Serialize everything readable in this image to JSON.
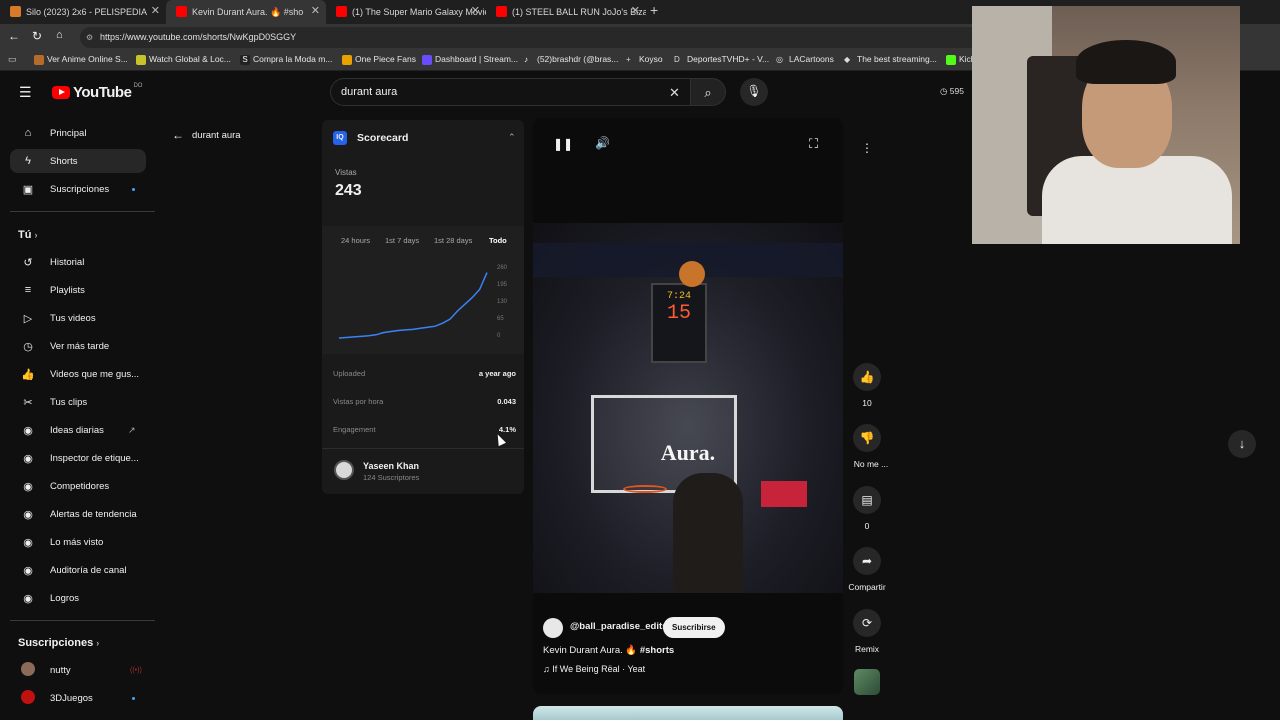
{
  "tabs": [
    {
      "title": "Silo (2023) 2x6 - PELISPEDIA",
      "fav_color": "#d97a2b"
    },
    {
      "title": "Kevin Durant Aura. 🔥 #sho",
      "fav_color": "#ff0000"
    },
    {
      "title": "(1) The Super Mario Galaxy Movie",
      "fav_color": "#ff0000"
    },
    {
      "title": "(1) STEEL BALL RUN JoJo's Bizarre",
      "fav_color": "#ff0000"
    }
  ],
  "address": {
    "url": "https://www.youtube.com/shorts/NwKgpD0SGGY"
  },
  "bookmarks": [
    "Ver Anime Online S...",
    "Watch Global & Loc...",
    "Compra la Moda m...",
    "One Piece Fans",
    "Dashboard | Stream...",
    "(52)brashdr (@bras...",
    "Koyso",
    "DeportesTVHD+ - V...",
    "LACartoons",
    "The best streaming...",
    "Kick"
  ],
  "header": {
    "logo": "YouTube",
    "country": "DO",
    "search_value": "durant aura",
    "right_badge": "595"
  },
  "sidebar": {
    "main": [
      "Principal",
      "Shorts",
      "Suscripciones"
    ],
    "you_heading": "Tú",
    "you": [
      "Historial",
      "Playlists",
      "Tus videos",
      "Ver más tarde",
      "Videos que me gus...",
      "Tus clips"
    ],
    "tools": [
      "Ideas diarias",
      "Inspector de etique...",
      "Competidores",
      "Alertas de tendencia",
      "Lo más visto",
      "Auditoría de canal",
      "Logros"
    ],
    "subs_heading": "Suscripciones",
    "subs": [
      "nutty",
      "3DJuegos"
    ]
  },
  "back": {
    "label": "durant aura"
  },
  "scorecard": {
    "title": "Scorecard",
    "views_label": "Vistas",
    "views_value": "243",
    "ranges": [
      "24 hours",
      "1st 7 days",
      "1st 28 days",
      "Todo"
    ],
    "active_range": "Todo",
    "y_ticks": [
      "260",
      "195",
      "130",
      "65",
      "0"
    ],
    "rows": [
      {
        "label": "Uploaded",
        "value": "a year ago"
      },
      {
        "label": "Vistas por hora",
        "value": "0.043"
      },
      {
        "label": "Engagement",
        "value": "4.1%"
      }
    ],
    "channel_name": "Yaseen Khan",
    "channel_subs": "124 Suscriptores"
  },
  "chart_data": {
    "type": "line",
    "x": [
      0,
      5,
      10,
      15,
      20,
      25,
      30,
      35,
      40,
      45,
      50,
      55,
      60,
      65,
      70,
      75,
      80,
      85,
      90,
      95,
      100
    ],
    "series": [
      {
        "values": [
          0,
          2,
          4,
          6,
          8,
          12,
          20,
          24,
          28,
          30,
          32,
          36,
          40,
          44,
          55,
          70,
          100,
          125,
          150,
          180,
          243
        ]
      }
    ],
    "ylim": [
      0,
      260
    ],
    "y_ticks": [
      0,
      65,
      130,
      195,
      260
    ]
  },
  "video": {
    "overlay_text": "Aura.",
    "channel": "@ball_paradise_edits",
    "subscribe": "Suscribirse",
    "caption_plain": "Kevin Durant Aura. 🔥 ",
    "caption_tag": "#shorts",
    "music": "If We Being Rëal · Yeat"
  },
  "actions": {
    "likes": "10",
    "dislike": "No me ...",
    "comments": "0",
    "share": "Compartir",
    "remix": "Remix"
  }
}
